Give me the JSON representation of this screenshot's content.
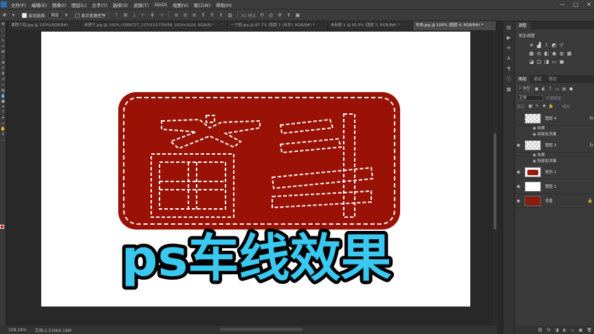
{
  "menubar": {
    "items": [
      "文件(F)",
      "编辑(E)",
      "图像(I)",
      "图层(L)",
      "文字(Y)",
      "选择(S)",
      "滤镜(T)",
      "3D(D)",
      "视图(V)",
      "窗口(W)",
      "帮助(H)"
    ],
    "window_controls": [
      "—",
      "▢",
      "✕"
    ]
  },
  "options": {
    "auto_select_label": "自动选择:",
    "auto_select_value": "图层",
    "transform_label": "显示变换控件",
    "mode_3d_label": "3D 模式:"
  },
  "doc_tabs": [
    "课程介绍.jpg @ 133%(RGB/8#)",
    "自颁子.jpg @ 100% (3386727_1270112770058_1024x1024, RGB/8) *",
    "一寸相.jpg @ 87.7% (图层 1 (合并), RGB/8#) *",
    "未标题-1 @ 60.9% (图层 2, RGB/8#) *",
    "车线.jpg @ 109% (图层 4, RGB/8#) *"
  ],
  "canvas": {
    "logo_text": "奋斗",
    "overlay_title": "ps车线效果",
    "colors": {
      "badge": "#9a1206",
      "stitch": "#ffffff",
      "title_fill": "#39c8ef",
      "title_stroke": "#000000"
    }
  },
  "status": {
    "zoom": "109.24%",
    "doc_info": "文档:2.51M/4.19M"
  },
  "panels": {
    "adjust_tab": "调整",
    "adjust_label": "添加调整",
    "layer_tabs": [
      "图层",
      "通道",
      "路径"
    ],
    "filter_kind": "P 类型",
    "blend_mode": "正常",
    "opacity_label": "不透明度:",
    "fill_label": "填充:",
    "lock_label": "锁定:",
    "layers": [
      {
        "name": "图层 4",
        "fx": "fx",
        "effects_label": "效果",
        "effect": "斜面和浮雕"
      },
      {
        "name": "图层 3",
        "fx": "fx",
        "effects_label": "效果",
        "effect": "斜面和浮雕"
      },
      {
        "name": "矩形 1"
      },
      {
        "name": "图层 1"
      },
      {
        "name": "背景"
      }
    ]
  }
}
